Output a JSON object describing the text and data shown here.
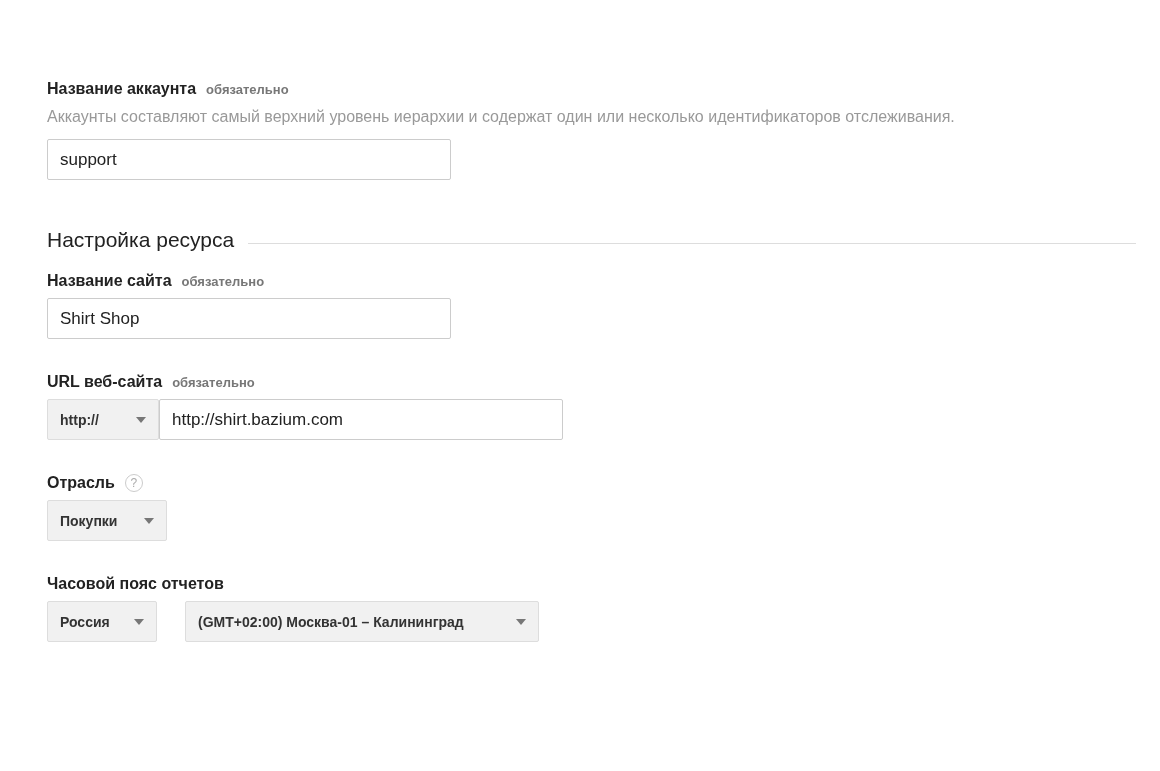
{
  "account": {
    "label": "Название аккаунта",
    "required": "обязательно",
    "description": "Аккаунты составляют самый верхний уровень иерархии и содержат один или несколько идентификаторов отслеживания.",
    "value": "support"
  },
  "section": {
    "title": "Настройка ресурса"
  },
  "site_name": {
    "label": "Название сайта",
    "required": "обязательно",
    "value": "Shirt Shop"
  },
  "site_url": {
    "label": "URL веб-сайта",
    "required": "обязательно",
    "protocol": "http://",
    "value": "http://shirt.bazium.com"
  },
  "industry": {
    "label": "Отрасль",
    "help": "?",
    "value": "Покупки"
  },
  "timezone": {
    "label": "Часовой пояс отчетов",
    "country": "Россия",
    "zone": "(GMT+02:00) Москва-01 – Калининград"
  }
}
